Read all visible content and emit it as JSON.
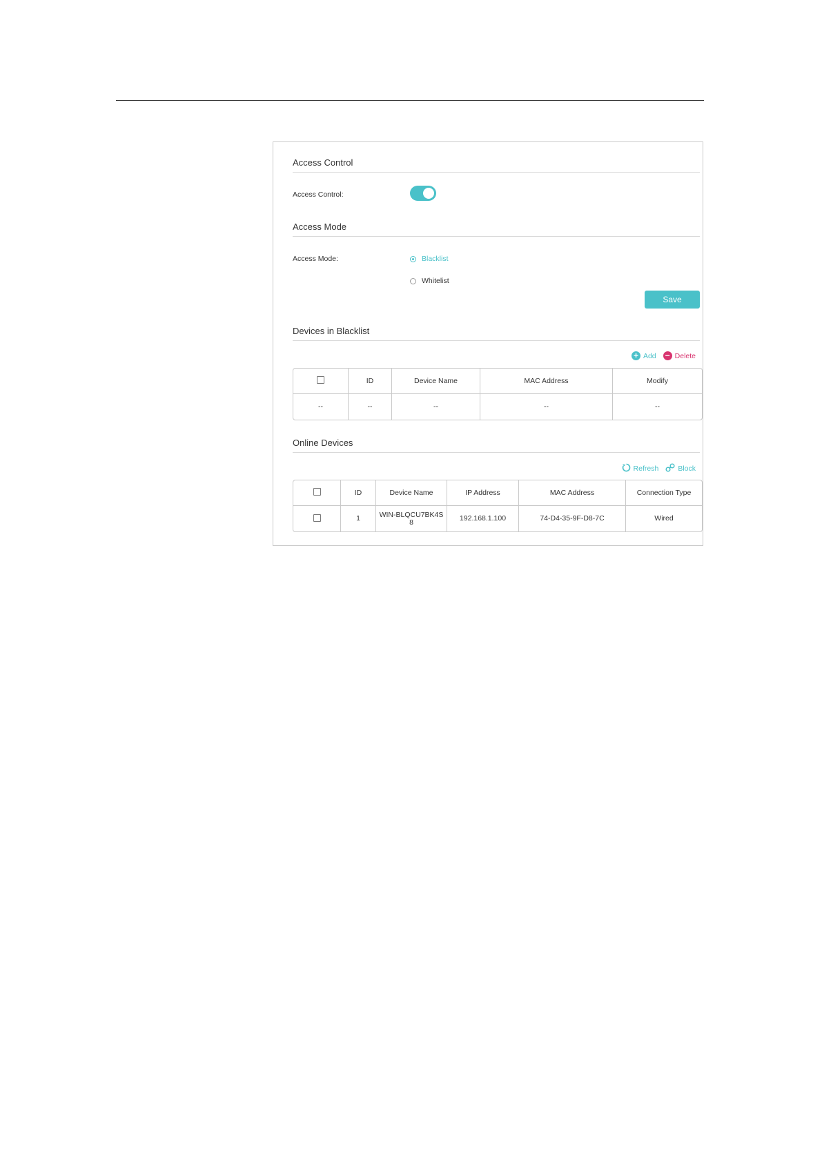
{
  "access_control": {
    "title": "Access Control",
    "label": "Access Control:",
    "enabled": true
  },
  "access_mode": {
    "title": "Access Mode",
    "label": "Access Mode:",
    "options": [
      "Blacklist",
      "Whitelist"
    ],
    "selected": "Blacklist",
    "save_label": "Save"
  },
  "blacklist": {
    "title": "Devices in Blacklist",
    "add_label": "Add",
    "delete_label": "Delete",
    "columns": [
      "",
      "ID",
      "Device Name",
      "MAC Address",
      "Modify"
    ],
    "rows": [
      [
        "--",
        "--",
        "--",
        "--",
        "--"
      ]
    ]
  },
  "online": {
    "title": "Online Devices",
    "refresh_label": "Refresh",
    "block_label": "Block",
    "columns": [
      "",
      "ID",
      "Device Name",
      "IP Address",
      "MAC Address",
      "Connection Type"
    ],
    "rows": [
      {
        "id": "1",
        "device_name": "WIN-BLQCU7BK4S8",
        "ip": "192.168.1.100",
        "mac": "74-D4-35-9F-D8-7C",
        "connection": "Wired"
      }
    ]
  },
  "colors": {
    "accent": "#4ac1c9",
    "delete": "#d8346f"
  }
}
